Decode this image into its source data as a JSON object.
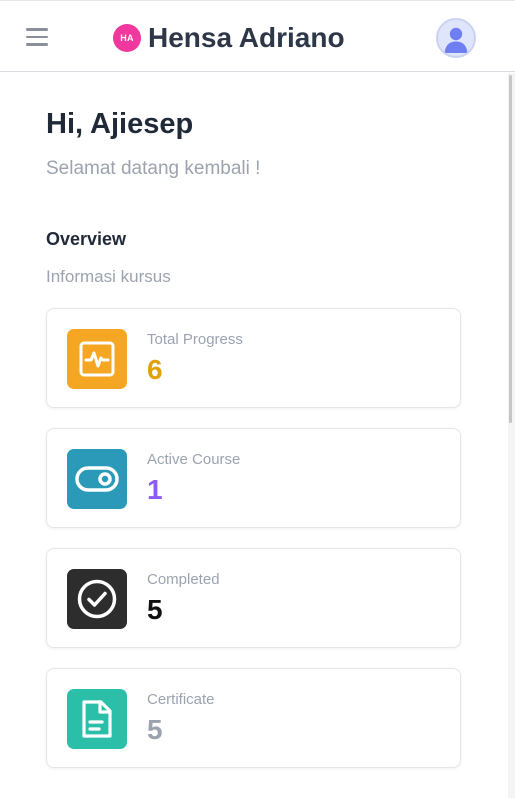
{
  "header": {
    "logo_text": "HA",
    "brand_name": "Hensa Adriano",
    "menu_icon": "hamburger-menu-icon",
    "avatar_icon": "user-avatar-icon"
  },
  "main": {
    "greeting": "Hi, Ajiesep",
    "subtitle": "Selamat datang kembali !",
    "overview_title": "Overview",
    "overview_subtitle": "Informasi kursus"
  },
  "stats": [
    {
      "label": "Total Progress",
      "value": "6",
      "icon": "activity-chart-icon",
      "icon_bg": "#f5a623",
      "value_color": "#e0a10c"
    },
    {
      "label": "Active Course",
      "value": "1",
      "icon": "toggle-icon",
      "icon_bg": "#2b9ab8",
      "value_color": "#8b5cf6"
    },
    {
      "label": "Completed",
      "value": "5",
      "icon": "check-circle-icon",
      "icon_bg": "#2d2d2d",
      "value_color": "#111111"
    },
    {
      "label": "Certificate",
      "value": "5",
      "icon": "document-icon",
      "icon_bg": "#2bbfaa",
      "value_color": "#9ca3af"
    }
  ],
  "colors": {
    "brand_logo": "#f0389e",
    "heading": "#1f2937",
    "muted": "#9ca3af"
  }
}
